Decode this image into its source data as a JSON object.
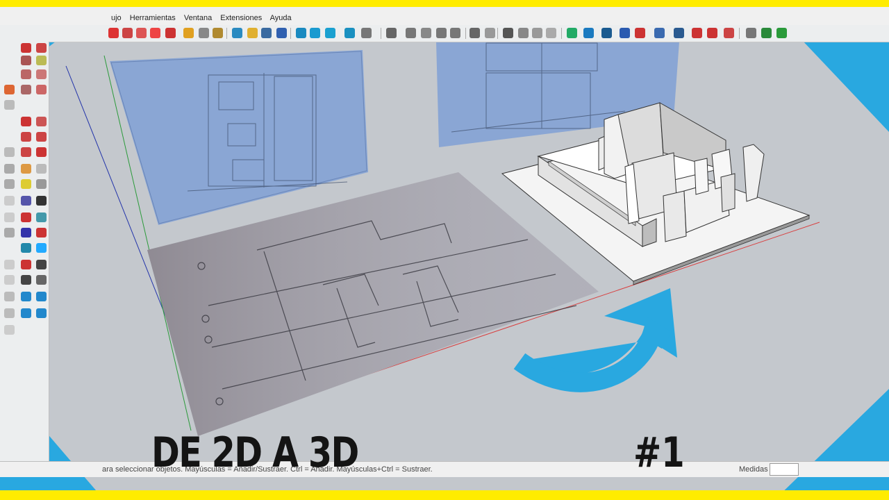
{
  "menu": {
    "items": [
      "ujo",
      "Herramientas",
      "Ventana",
      "Extensiones",
      "Ayuda"
    ]
  },
  "status": {
    "hint": "ara seleccionar objetos. Mayúsculas = Añadir/Sustraer. Ctrl = Añadir. Mayúsculas+Ctrl = Sustraer.",
    "measure_label": "Medidas",
    "measure_value": ""
  },
  "overlay": {
    "title": "DE 2D A 3D",
    "episode": "#1"
  },
  "colors": {
    "accent_blue": "#29a8e0",
    "banner_yellow": "#ffec00",
    "title_text": "#141414"
  },
  "icons": [
    "select-arrow-icon",
    "paint-bucket-icon",
    "eraser-icon",
    "pencil-icon",
    "push-pull-icon",
    "move-icon",
    "rotate-icon",
    "tape-measure-icon",
    "orbit-icon",
    "pan-icon",
    "zoom-icon",
    "zoom-extents-icon",
    "camera-icon",
    "walk-icon",
    "section-plane-icon",
    "layers-icon"
  ]
}
